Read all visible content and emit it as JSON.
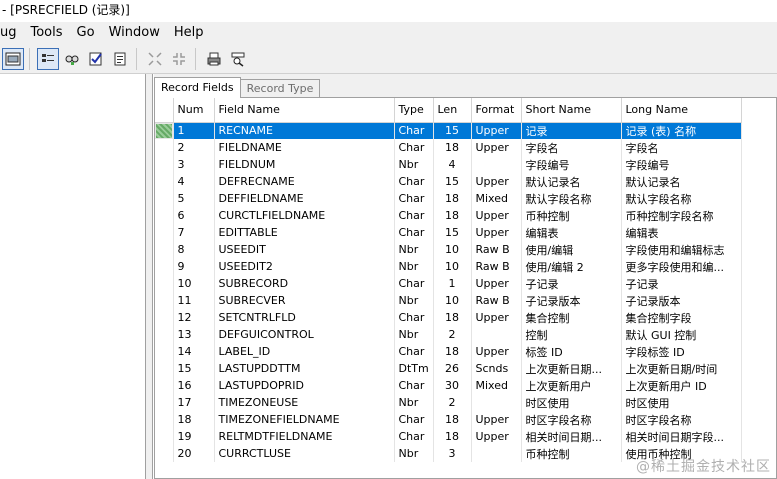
{
  "window": {
    "title": "- [PSRECFIELD (记录)]"
  },
  "menu": [
    "ug",
    "Tools",
    "Go",
    "Window",
    "Help"
  ],
  "toolbar": {
    "icons": [
      "window-icon",
      "view-list-icon",
      "find-icon",
      "validate-icon",
      "properties-icon",
      "expand-icon",
      "collapse-icon",
      "print-icon",
      "find-definition-icon"
    ]
  },
  "tabs": {
    "record_fields": "Record Fields",
    "record_type": "Record Type"
  },
  "grid": {
    "columns": [
      "Num",
      "Field Name",
      "Type",
      "Len",
      "Format",
      "Short Name",
      "Long Name"
    ],
    "rows": [
      [
        "1",
        "RECNAME",
        "Char",
        "15",
        "Upper",
        "记录",
        "记录 (表) 名称"
      ],
      [
        "2",
        "FIELDNAME",
        "Char",
        "18",
        "Upper",
        "字段名",
        "字段名"
      ],
      [
        "3",
        "FIELDNUM",
        "Nbr",
        "4",
        "",
        "字段编号",
        "字段编号"
      ],
      [
        "4",
        "DEFRECNAME",
        "Char",
        "15",
        "Upper",
        "默认记录名",
        "默认记录名"
      ],
      [
        "5",
        "DEFFIELDNAME",
        "Char",
        "18",
        "Mixed",
        "默认字段名称",
        "默认字段名称"
      ],
      [
        "6",
        "CURCTLFIELDNAME",
        "Char",
        "18",
        "Upper",
        "币种控制",
        "币种控制字段名称"
      ],
      [
        "7",
        "EDITTABLE",
        "Char",
        "15",
        "Upper",
        "编辑表",
        "编辑表"
      ],
      [
        "8",
        "USEEDIT",
        "Nbr",
        "10",
        "Raw B",
        "使用/编辑",
        "字段使用和编辑标志"
      ],
      [
        "9",
        "USEEDIT2",
        "Nbr",
        "10",
        "Raw B",
        "使用/编辑 2",
        "更多字段使用和编..."
      ],
      [
        "10",
        "SUBRECORD",
        "Char",
        "1",
        "Upper",
        "子记录",
        "子记录"
      ],
      [
        "11",
        "SUBRECVER",
        "Nbr",
        "10",
        "Raw B",
        "子记录版本",
        "子记录版本"
      ],
      [
        "12",
        "SETCNTRLFLD",
        "Char",
        "18",
        "Upper",
        "集合控制",
        "集合控制字段"
      ],
      [
        "13",
        "DEFGUICONTROL",
        "Nbr",
        "2",
        "",
        "控制",
        "默认 GUI 控制"
      ],
      [
        "14",
        "LABEL_ID",
        "Char",
        "18",
        "Upper",
        "标签 ID",
        "字段标签 ID"
      ],
      [
        "15",
        "LASTUPDDTTM",
        "DtTm",
        "26",
        "Scnds",
        "上次更新日期...",
        "上次更新日期/时间"
      ],
      [
        "16",
        "LASTUPDOPRID",
        "Char",
        "30",
        "Mixed",
        "上次更新用户",
        "上次更新用户 ID"
      ],
      [
        "17",
        "TIMEZONEUSE",
        "Nbr",
        "2",
        "",
        "时区使用",
        "时区使用"
      ],
      [
        "18",
        "TIMEZONEFIELDNAME",
        "Char",
        "18",
        "Upper",
        "时区字段名称",
        "时区字段名称"
      ],
      [
        "19",
        "RELTMDTFIELDNAME",
        "Char",
        "18",
        "Upper",
        "相关时间日期...",
        "相关时间日期字段..."
      ],
      [
        "20",
        "CURRCTLUSE",
        "Nbr",
        "3",
        "",
        "币种控制",
        "使用币种控制"
      ]
    ],
    "selected_row": 1
  },
  "watermark": "@稀土掘金技术社区",
  "colors": {
    "selection": "#0078d7",
    "toolbar_bg": "#f0f0f0"
  }
}
